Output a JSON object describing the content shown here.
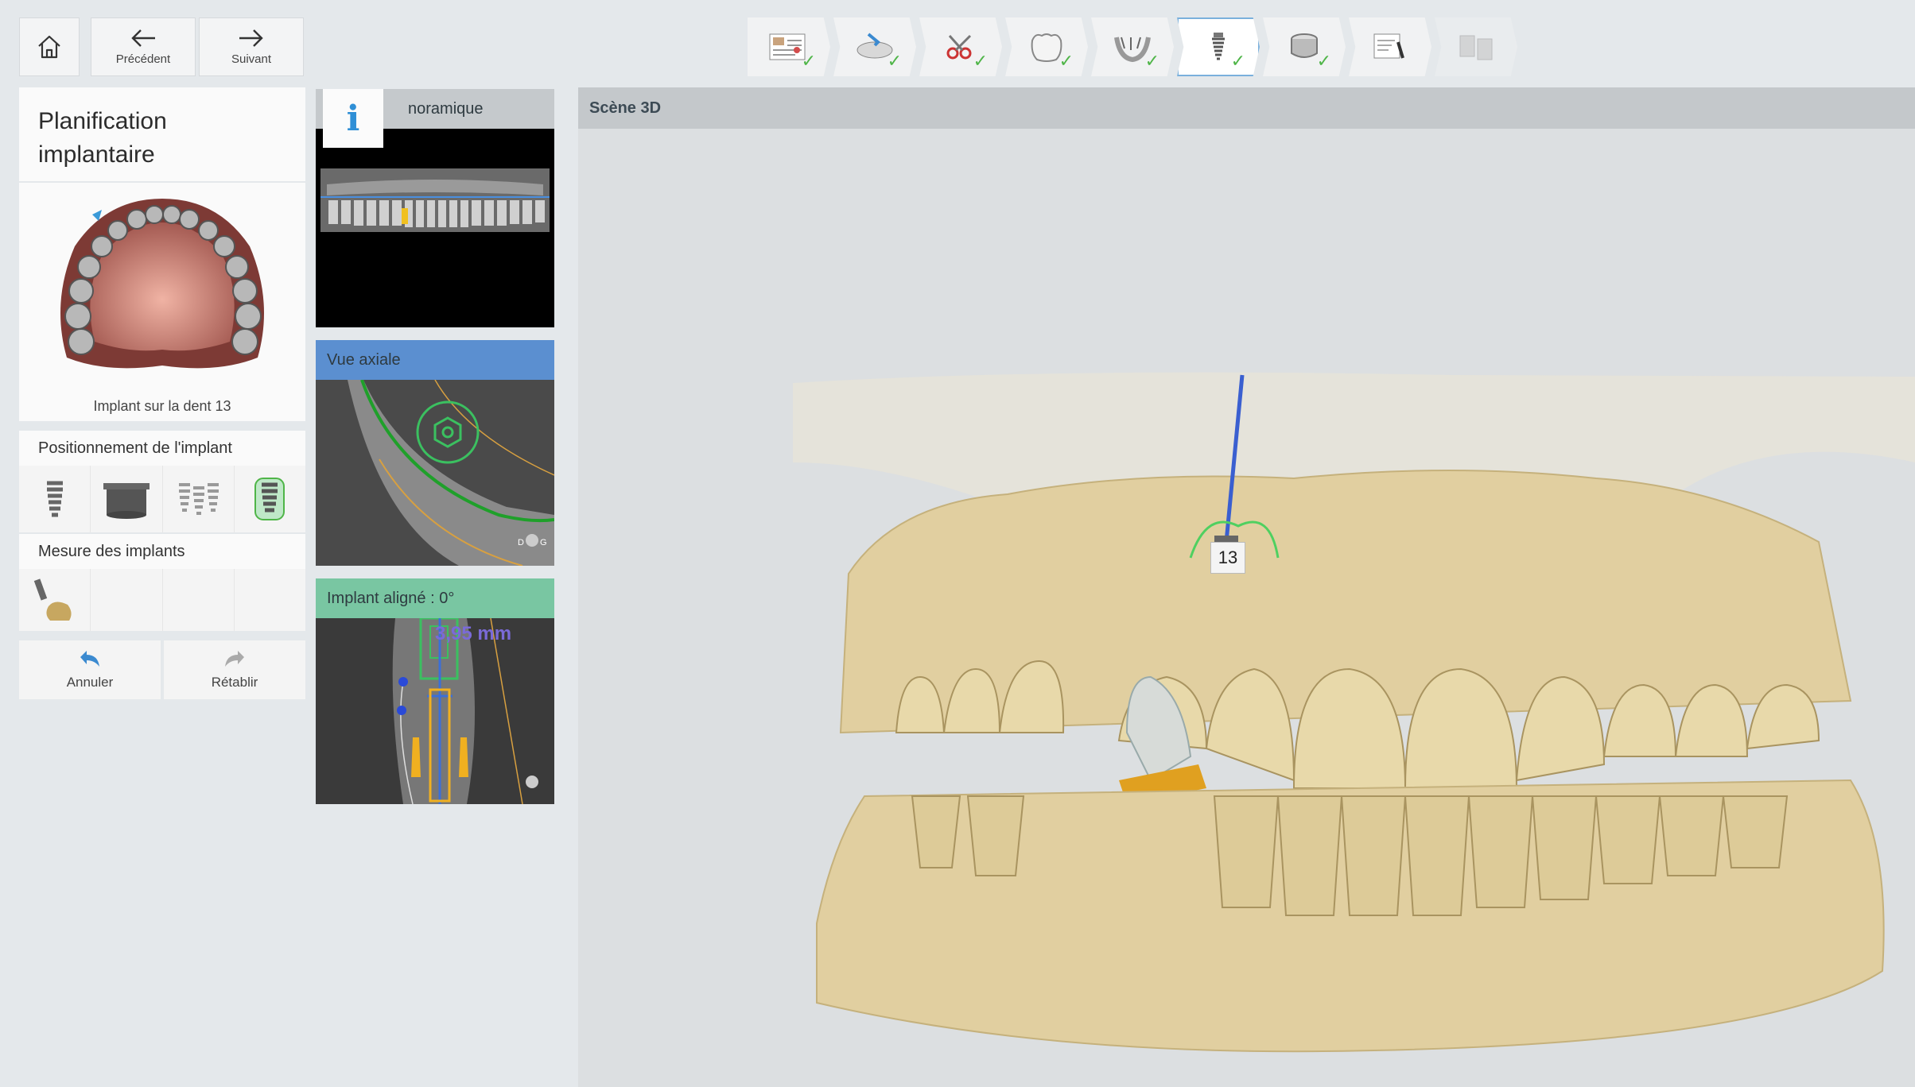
{
  "nav": {
    "home_icon": "home-icon",
    "prev_label": "Précédent",
    "next_label": "Suivant"
  },
  "workflow": {
    "steps": [
      {
        "icon": "prescription-icon",
        "state": "done"
      },
      {
        "icon": "scan-import-icon",
        "state": "done"
      },
      {
        "icon": "tools-icon",
        "state": "done"
      },
      {
        "icon": "crown-icon",
        "state": "done"
      },
      {
        "icon": "cbct-jaw-icon",
        "state": "done"
      },
      {
        "icon": "implant-icon",
        "state": "active-done"
      },
      {
        "icon": "guide-sleeve-icon",
        "state": "done"
      },
      {
        "icon": "guide-design-icon",
        "state": "current"
      },
      {
        "icon": "export-icon",
        "state": "disabled"
      }
    ]
  },
  "left_panel": {
    "title_line1": "Planification",
    "title_line2": "implantaire",
    "model_caption": "Implant sur la dent 13",
    "positioning_label": "Positionnement de l'implant",
    "measure_label": "Mesure des implants",
    "undo_label": "Annuler",
    "redo_label": "Rétablir"
  },
  "views": {
    "panoramic_label": "Vue panoramique",
    "panoramic_visible": "noramique",
    "axial_label": "Vue axiale",
    "aligned_label": "Implant aligné : 0°",
    "measure_value": "3,95 mm"
  },
  "scene": {
    "title": "Scène 3D",
    "tooth_number": "13"
  },
  "colors": {
    "accent_blue": "#2f8fd6",
    "check_green": "#4fb548",
    "axial_header": "#5b8fd0",
    "aligned_header": "#79c6a2",
    "model_beige": "#e0cf9c"
  }
}
